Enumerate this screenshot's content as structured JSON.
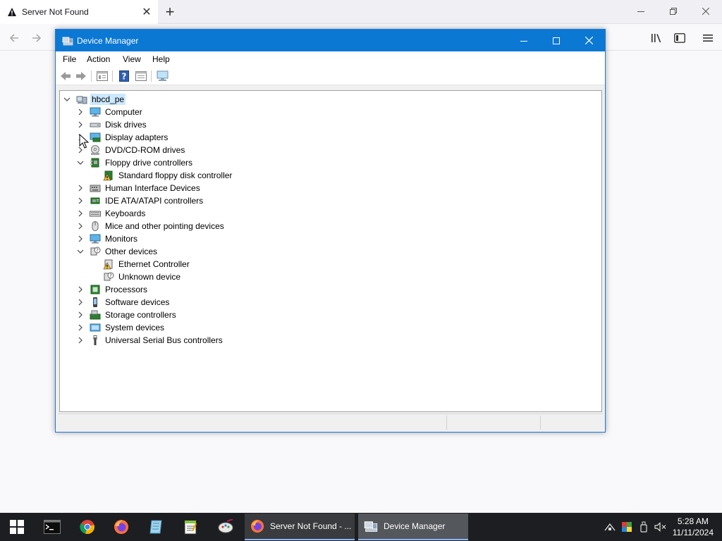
{
  "browser": {
    "tab_title": "Server Not Found",
    "tab_close": "✕",
    "new_tab": "+"
  },
  "dm": {
    "title": "Device Manager",
    "menu": [
      "File",
      "Action",
      "View",
      "Help"
    ],
    "tree": {
      "root": "hbcd_pe",
      "items": [
        {
          "label": "Computer",
          "expanded": false
        },
        {
          "label": "Disk drives",
          "expanded": false
        },
        {
          "label": "Display adapters",
          "expanded": false
        },
        {
          "label": "DVD/CD-ROM drives",
          "expanded": false
        },
        {
          "label": "Floppy drive controllers",
          "expanded": true
        },
        {
          "label": "Standard floppy disk controller",
          "child": true
        },
        {
          "label": "Human Interface Devices",
          "expanded": false
        },
        {
          "label": "IDE ATA/ATAPI controllers",
          "expanded": false
        },
        {
          "label": "Keyboards",
          "expanded": false
        },
        {
          "label": "Mice and other pointing devices",
          "expanded": false
        },
        {
          "label": "Monitors",
          "expanded": false
        },
        {
          "label": "Other devices",
          "expanded": true
        },
        {
          "label": "Ethernet Controller",
          "child": true
        },
        {
          "label": "Unknown device",
          "child": true
        },
        {
          "label": "Processors",
          "expanded": false
        },
        {
          "label": "Software devices",
          "expanded": false
        },
        {
          "label": "Storage controllers",
          "expanded": false
        },
        {
          "label": "System devices",
          "expanded": false
        },
        {
          "label": "Universal Serial Bus controllers",
          "expanded": false
        }
      ]
    }
  },
  "taskbar": {
    "tasks": [
      {
        "label": "Server Not Found - ..."
      },
      {
        "label": "Device Manager"
      }
    ],
    "clock": {
      "time": "5:28 AM",
      "date": "11/11/2024"
    }
  },
  "colors": {
    "titlebar": "#0b78d4",
    "taskbar": "#1d1e21",
    "selection": "#cce8ff"
  }
}
